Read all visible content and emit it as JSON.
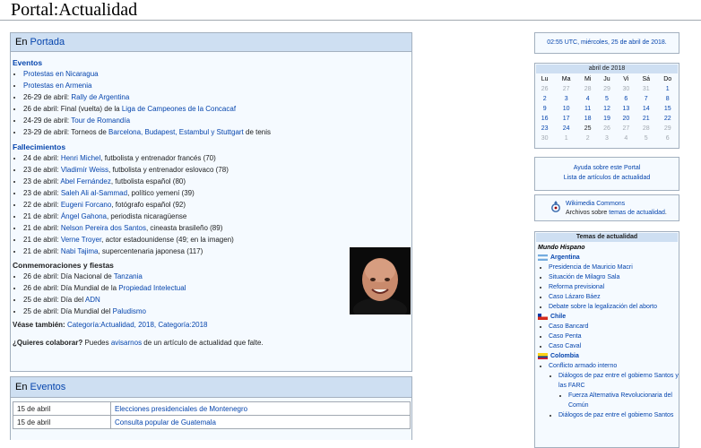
{
  "page": {
    "title": "Portal:Actualidad"
  },
  "portada": {
    "heading_prefix": "En",
    "heading_link": "Portada",
    "eventos_title": "Eventos",
    "eventos": [
      {
        "pre": "",
        "link": "Protestas en Nicaragua",
        "post": ""
      },
      {
        "pre": "",
        "link": "Protestas en Armenia",
        "post": ""
      },
      {
        "pre": "26-29 de abril: ",
        "link": "Rally de Argentina",
        "post": ""
      },
      {
        "pre": "26 de abril: Final (vuelta) de la ",
        "link": "Liga de Campeones de la Concacaf",
        "post": ""
      },
      {
        "pre": "24-29 de abril: ",
        "link": "Tour de Romandía",
        "post": ""
      },
      {
        "pre": "23-29 de abril: Torneos de ",
        "link": "Barcelona, Budapest, Estambul y Stuttgart",
        "post": " de tenis"
      }
    ],
    "fallecimientos_title": "Fallecimientos",
    "fallecimientos": [
      {
        "pre": "24 de abril: ",
        "link": "Henri Michel",
        "post": ", futbolista y entrenador francés (70)"
      },
      {
        "pre": "23 de abril: ",
        "link": "Vladimír Weiss",
        "post": ", futbolista y entrenador eslovaco (78)"
      },
      {
        "pre": "23 de abril: ",
        "link": "Abel Fernández",
        "post": ", futbolista español (80)"
      },
      {
        "pre": "23 de abril: ",
        "link": "Saleh Ali al-Sammad",
        "post": ", político yemení (39)"
      },
      {
        "pre": "22 de abril: ",
        "link": "Eugeni Forcano",
        "post": ", fotógrafo español (92)"
      },
      {
        "pre": "21 de abril: ",
        "link": "Ángel Gahona",
        "post": ", periodista nicaragüense"
      },
      {
        "pre": "21 de abril: ",
        "link": "Nelson Pereira dos Santos",
        "post": ", cineasta brasileño (89)"
      },
      {
        "pre": "21 de abril: ",
        "link": "Verne Troyer",
        "post": ", actor estadounidense (49; en la imagen)"
      },
      {
        "pre": "21 de abril: ",
        "link": "Nabi Tajima",
        "post": ", supercentenaria japonesa (117)"
      }
    ],
    "conmemoraciones_title": "Conmemoraciones y fiestas",
    "conmemoraciones": [
      {
        "pre": "26 de abril: Día Nacional de ",
        "link": "Tanzania",
        "post": ""
      },
      {
        "pre": "26 de abril: Día Mundial de la ",
        "link": "Propiedad Intelectual",
        "post": ""
      },
      {
        "pre": "25 de abril: Día del ",
        "link": "ADN",
        "post": ""
      },
      {
        "pre": "25 de abril: Día Mundial del ",
        "link": "Paludismo",
        "post": ""
      }
    ],
    "see_also_label": "Véase también:",
    "see_also_links": "Categoría:Actualidad, 2018, Categoría:2018",
    "collab_bold": "¿Quieres colaborar?",
    "collab_pre": " Puedes ",
    "collab_link": "avisarnos",
    "collab_post": " de un artículo de actualidad que falte."
  },
  "eventos_panel": {
    "heading_prefix": "En",
    "heading_link": "Eventos",
    "rows": [
      {
        "date": "15 de abril",
        "event": "Elecciones presidenciales de Montenegro"
      },
      {
        "date": "15 de abril",
        "event": "Consulta popular de Guatemala"
      }
    ]
  },
  "sidebar": {
    "datetime": "02:55 UTC, miércoles, 25 de abril de 2018.",
    "calendar": {
      "month": "abril de 2018",
      "days": [
        "Lu",
        "Ma",
        "Mi",
        "Ju",
        "Vi",
        "Sá",
        "Do"
      ],
      "weeks": [
        [
          [
            "26",
            "off"
          ],
          [
            "27",
            "off"
          ],
          [
            "28",
            "off"
          ],
          [
            "29",
            "off"
          ],
          [
            "30",
            "off"
          ],
          [
            "31",
            "off"
          ],
          [
            "1",
            "on"
          ]
        ],
        [
          [
            "2",
            "on"
          ],
          [
            "3",
            "on"
          ],
          [
            "4",
            "on"
          ],
          [
            "5",
            "on"
          ],
          [
            "6",
            "on"
          ],
          [
            "7",
            "on"
          ],
          [
            "8",
            "on"
          ]
        ],
        [
          [
            "9",
            "on"
          ],
          [
            "10",
            "on"
          ],
          [
            "11",
            "on"
          ],
          [
            "12",
            "on"
          ],
          [
            "13",
            "on"
          ],
          [
            "14",
            "on"
          ],
          [
            "15",
            "on"
          ]
        ],
        [
          [
            "16",
            "on"
          ],
          [
            "17",
            "on"
          ],
          [
            "18",
            "on"
          ],
          [
            "19",
            "on"
          ],
          [
            "20",
            "on"
          ],
          [
            "21",
            "on"
          ],
          [
            "22",
            "on"
          ]
        ],
        [
          [
            "23",
            "on"
          ],
          [
            "24",
            "on"
          ],
          [
            "25",
            "cur"
          ],
          [
            "26",
            "off"
          ],
          [
            "27",
            "off"
          ],
          [
            "28",
            "off"
          ],
          [
            "29",
            "off"
          ]
        ],
        [
          [
            "30",
            "off"
          ],
          [
            "1",
            "off"
          ],
          [
            "2",
            "off"
          ],
          [
            "3",
            "off"
          ],
          [
            "4",
            "off"
          ],
          [
            "5",
            "off"
          ],
          [
            "6",
            "off"
          ]
        ]
      ]
    },
    "help_link": "Ayuda sobre este Portal",
    "list_link": "Lista de artículos de actualidad",
    "commons_title": "Wikimedia Commons",
    "commons_pre": "Archivos sobre ",
    "commons_link": "temas de actualidad",
    "commons_post": ".",
    "temas_title": "Temas de actualidad",
    "mundo": "Mundo Hispano",
    "countries": [
      {
        "name": "Argentina",
        "flag": "ar",
        "items": [
          "Presidencia de Mauricio Macri",
          "Situación de Milagro Sala",
          "Reforma previsional",
          "Caso Lázaro Báez",
          "Debate sobre la legalización del aborto"
        ]
      },
      {
        "name": "Chile",
        "flag": "cl",
        "items": [
          "Caso Bancard",
          "Caso Penta",
          "Caso Caval"
        ]
      },
      {
        "name": "Colombia",
        "flag": "co",
        "items": [
          "Conflicto armado interno"
        ]
      }
    ],
    "colombia_sub": "Diálogos de paz entre el gobierno Santos y las FARC",
    "colombia_subsub": "Fuerza Alternativa Revolucionaria del Común",
    "colombia_sub2": "Diálogos de paz entre el gobierno Santos"
  }
}
